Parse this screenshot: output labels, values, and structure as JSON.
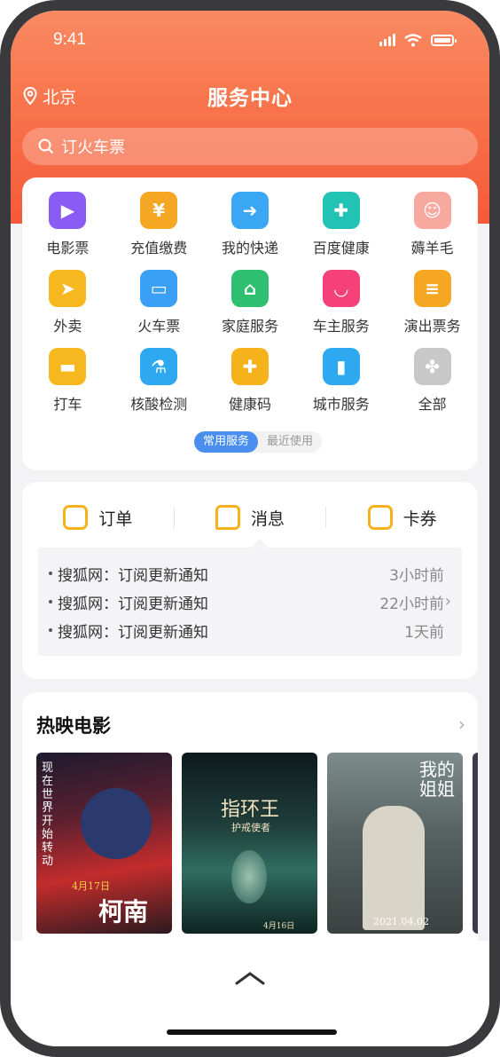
{
  "status": {
    "time": "9:41"
  },
  "header": {
    "location": "北京",
    "title": "服务中心"
  },
  "search": {
    "placeholder": "订火车票"
  },
  "services": {
    "items": [
      {
        "label": "电影票",
        "icon": "movie-ticket-icon",
        "color": "#8a5cf5"
      },
      {
        "label": "充值缴费",
        "icon": "recharge-icon",
        "color": "#f5a623"
      },
      {
        "label": "我的快递",
        "icon": "express-box-icon",
        "color": "#3aa7f5"
      },
      {
        "label": "百度健康",
        "icon": "health-plus-icon",
        "color": "#22c3b5"
      },
      {
        "label": "薅羊毛",
        "icon": "sheep-icon",
        "color": "#f7a9a0"
      },
      {
        "label": "外卖",
        "icon": "takeout-icon",
        "color": "#f7b81f"
      },
      {
        "label": "火车票",
        "icon": "train-icon",
        "color": "#3aa0f5"
      },
      {
        "label": "家庭服务",
        "icon": "home-service-icon",
        "color": "#2fbf71"
      },
      {
        "label": "车主服务",
        "icon": "car-owner-icon",
        "color": "#f5407a"
      },
      {
        "label": "演出票务",
        "icon": "show-ticket-icon",
        "color": "#f5a623"
      },
      {
        "label": "打车",
        "icon": "taxi-icon",
        "color": "#f7b81f"
      },
      {
        "label": "核酸检测",
        "icon": "test-flask-icon",
        "color": "#2ea8f0"
      },
      {
        "label": "健康码",
        "icon": "health-code-icon",
        "color": "#f6b21b"
      },
      {
        "label": "城市服务",
        "icon": "city-service-icon",
        "color": "#2ea8f0"
      },
      {
        "label": "全部",
        "icon": "all-grid-icon",
        "color": "#c8c8c8"
      }
    ],
    "segment": {
      "active": "常用服务",
      "inactive": "最近使用"
    }
  },
  "messages": {
    "tabs": [
      {
        "label": "订单",
        "icon": "order-clipboard-icon"
      },
      {
        "label": "消息",
        "icon": "message-bubble-icon"
      },
      {
        "label": "卡券",
        "icon": "coupon-wallet-icon"
      }
    ],
    "rows": [
      {
        "text": "搜狐网：订阅更新通知",
        "time": "3小时前"
      },
      {
        "text": "搜狐网：订阅更新通知",
        "time": "22小时前"
      },
      {
        "text": "搜狐网：订阅更新通知",
        "time": "1天前"
      }
    ]
  },
  "movies": {
    "title": "热映电影",
    "posters": [
      {
        "caption": "柯南",
        "tagline": "现在世界开始转动",
        "date": "4月17日"
      },
      {
        "caption": "指环王",
        "subtitle": "护戒使者",
        "date": "4月16日"
      },
      {
        "caption": "我的姐姐",
        "date": "2021.04.02"
      }
    ]
  },
  "colors": {
    "header": "#f8744c",
    "accent": "#4a8ff0",
    "tabIcon": "#f6b21b"
  }
}
